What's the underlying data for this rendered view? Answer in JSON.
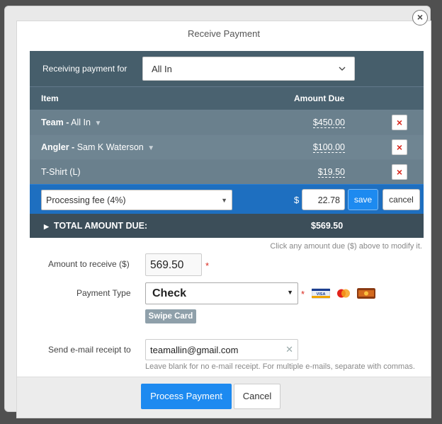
{
  "modal": {
    "title": "Receive Payment",
    "close_glyph": "×"
  },
  "header": {
    "receiving_label": "Receiving payment for",
    "receiving_value": "All In"
  },
  "table": {
    "col_item": "Item",
    "col_amount": "Amount Due",
    "rows": [
      {
        "bold": "Team -",
        "name": " All In",
        "amount": "$450.00"
      },
      {
        "bold": "Angler -",
        "name": " Sam K Waterson",
        "amount": "$100.00"
      },
      {
        "bold": "",
        "name": "T-Shirt (L)",
        "amount": "$19.50"
      }
    ],
    "remove_glyph": "×",
    "fee": {
      "select_value": "Processing fee (4%)",
      "currency": "$",
      "amount": "22.78",
      "save_label": "save",
      "cancel_label": "cancel"
    },
    "total_label": "TOTAL AMOUNT DUE:",
    "total_value": "$569.50"
  },
  "hint": "Click any amount due ($) above to modify it.",
  "form": {
    "amount_label": "Amount to receive ($)",
    "amount_value": "569.50",
    "required_mark": "*",
    "payment_type_label": "Payment Type",
    "payment_type_value": "Check",
    "swipe_label": "Swipe Card",
    "email_label": "Send e-mail receipt to",
    "email_value": "teamallin@gmail.com",
    "email_help": "Leave blank for no e-mail receipt. For multiple e-mails, separate with commas."
  },
  "footer": {
    "process_label": "Process Payment",
    "cancel_label": "Cancel"
  },
  "colors": {
    "accent": "#1d8af0",
    "panel": "#556b78",
    "fee_row": "#1e6fc0",
    "remove": "#d9281e"
  }
}
